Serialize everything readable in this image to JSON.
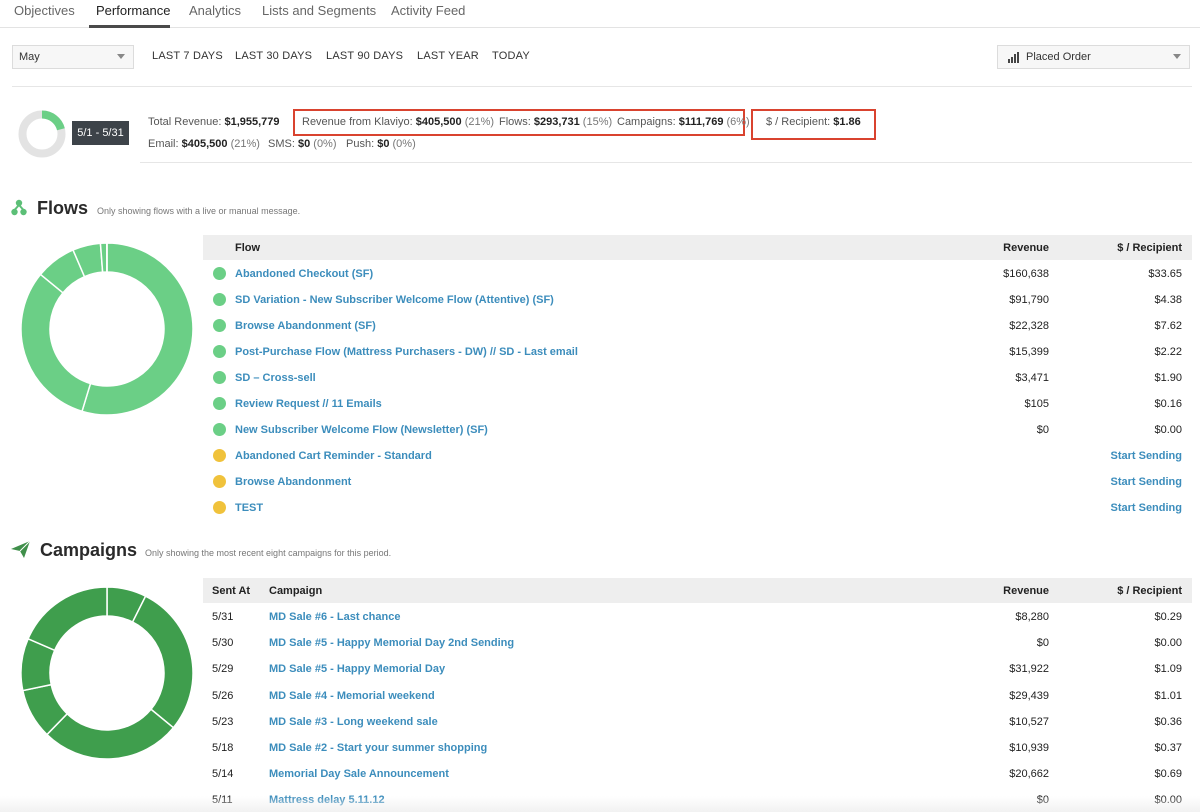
{
  "tabs": [
    {
      "label": "Objectives"
    },
    {
      "label": "Performance"
    },
    {
      "label": "Analytics"
    },
    {
      "label": "Lists and Segments"
    },
    {
      "label": "Activity Feed"
    }
  ],
  "filters": {
    "month": "May",
    "ranges": [
      "LAST 7 DAYS",
      "LAST 30 DAYS",
      "LAST 90 DAYS",
      "LAST YEAR",
      "TODAY"
    ],
    "metric": "Placed Order"
  },
  "summary": {
    "date_range": "5/1 - 5/31",
    "total_revenue_label": "Total Revenue:",
    "total_revenue": "$1,955,779",
    "klaviyo_label": "Revenue from Klaviyo:",
    "klaviyo_value": "$405,500",
    "klaviyo_pct": "(21%)",
    "flows_label": "Flows:",
    "flows_value": "$293,731",
    "flows_pct": "(15%)",
    "campaigns_label": "Campaigns:",
    "campaigns_value": "$111,769",
    "campaigns_pct": "(6%)",
    "recipient_label": "$ / Recipient:",
    "recipient_value": "$1.86",
    "email_label": "Email:",
    "email_value": "$405,500",
    "email_pct": "(21%)",
    "sms_label": "SMS:",
    "sms_value": "$0",
    "sms_pct": "(0%)",
    "push_label": "Push:",
    "push_value": "$0",
    "push_pct": "(0%)",
    "donut_fraction": 0.21
  },
  "flows": {
    "title": "Flows",
    "subtitle": "Only showing flows with a live or manual message.",
    "columns": {
      "flow": "Flow",
      "revenue": "Revenue",
      "recipient": "$ / Recipient"
    },
    "rows": [
      {
        "status": "live",
        "name": "Abandoned Checkout (SF)",
        "revenue": "$160,638",
        "recipient": "$33.65"
      },
      {
        "status": "live",
        "name": "SD Variation - New Subscriber Welcome Flow (Attentive) (SF)",
        "revenue": "$91,790",
        "recipient": "$4.38"
      },
      {
        "status": "live",
        "name": "Browse Abandonment (SF)",
        "revenue": "$22,328",
        "recipient": "$7.62"
      },
      {
        "status": "live",
        "name": "Post-Purchase Flow (Mattress Purchasers - DW) // SD - Last email",
        "revenue": "$15,399",
        "recipient": "$2.22"
      },
      {
        "status": "live",
        "name": "SD – Cross-sell",
        "revenue": "$3,471",
        "recipient": "$1.90"
      },
      {
        "status": "live",
        "name": "Review Request // 11 Emails",
        "revenue": "$105",
        "recipient": "$0.16"
      },
      {
        "status": "live",
        "name": "New Subscriber Welcome Flow (Newsletter) (SF)",
        "revenue": "$0",
        "recipient": "$0.00"
      },
      {
        "status": "manual",
        "name": "Abandoned Cart Reminder - Standard",
        "revenue": "",
        "recipient": "Start Sending"
      },
      {
        "status": "manual",
        "name": "Browse Abandonment",
        "revenue": "",
        "recipient": "Start Sending"
      },
      {
        "status": "manual",
        "name": "TEST",
        "revenue": "",
        "recipient": "Start Sending"
      }
    ],
    "donut_values": [
      160638,
      91790,
      22328,
      15399,
      3471,
      105
    ],
    "color": "#6bcf86"
  },
  "campaigns": {
    "title": "Campaigns",
    "subtitle": "Only showing the most recent eight campaigns for this period.",
    "columns": {
      "sent": "Sent At",
      "campaign": "Campaign",
      "revenue": "Revenue",
      "recipient": "$ / Recipient"
    },
    "rows": [
      {
        "sent": "5/31",
        "name": "MD Sale #6 - Last chance",
        "revenue": "$8,280",
        "recipient": "$0.29"
      },
      {
        "sent": "5/30",
        "name": "MD Sale #5 - Happy Memorial Day 2nd Sending",
        "revenue": "$0",
        "recipient": "$0.00"
      },
      {
        "sent": "5/29",
        "name": "MD Sale #5 - Happy Memorial Day",
        "revenue": "$31,922",
        "recipient": "$1.09"
      },
      {
        "sent": "5/26",
        "name": "MD Sale #4 - Memorial weekend",
        "revenue": "$29,439",
        "recipient": "$1.01"
      },
      {
        "sent": "5/23",
        "name": "MD Sale #3 - Long weekend sale",
        "revenue": "$10,527",
        "recipient": "$0.36"
      },
      {
        "sent": "5/18",
        "name": "MD Sale #2 - Start your summer shopping",
        "revenue": "$10,939",
        "recipient": "$0.37"
      },
      {
        "sent": "5/14",
        "name": "Memorial Day Sale Announcement",
        "revenue": "$20,662",
        "recipient": "$0.69"
      },
      {
        "sent": "5/11",
        "name": "Mattress delay 5.11.12",
        "revenue": "$0",
        "recipient": "$0.00"
      }
    ],
    "donut_values": [
      8280,
      31922,
      29439,
      10527,
      10939,
      20662
    ],
    "color": "#3f9e4d"
  },
  "colors": {
    "live": "#6bcf86",
    "manual": "#f0c23b",
    "link": "#3c8dbc",
    "highlight": "#d9432f"
  },
  "icons": {
    "flows": "flow-network-icon",
    "campaigns": "paper-plane-icon",
    "metric": "bar-chart-icon"
  }
}
